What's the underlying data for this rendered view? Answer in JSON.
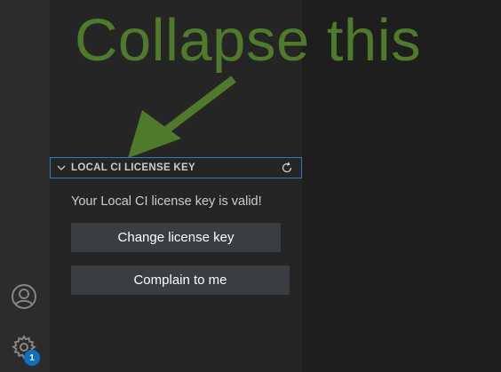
{
  "annotation": {
    "text": "Collapse this"
  },
  "section": {
    "title": "LOCAL CI LICENSE KEY",
    "chevron_icon": "chevron-down-icon",
    "refresh_icon": "refresh-icon"
  },
  "license": {
    "status_message": "Your Local CI license key is valid!",
    "change_button_label": "Change license key",
    "complain_button_label": "Complain to me"
  },
  "activity_bar": {
    "account_icon": "account-icon",
    "manage_icon": "gear-icon",
    "manage_badge_count": "1"
  },
  "colors": {
    "annotation": "#4f7a2c",
    "focus_border": "#2f78c4",
    "button_bg": "#3a3d41",
    "badge_bg": "#0e70c0"
  }
}
